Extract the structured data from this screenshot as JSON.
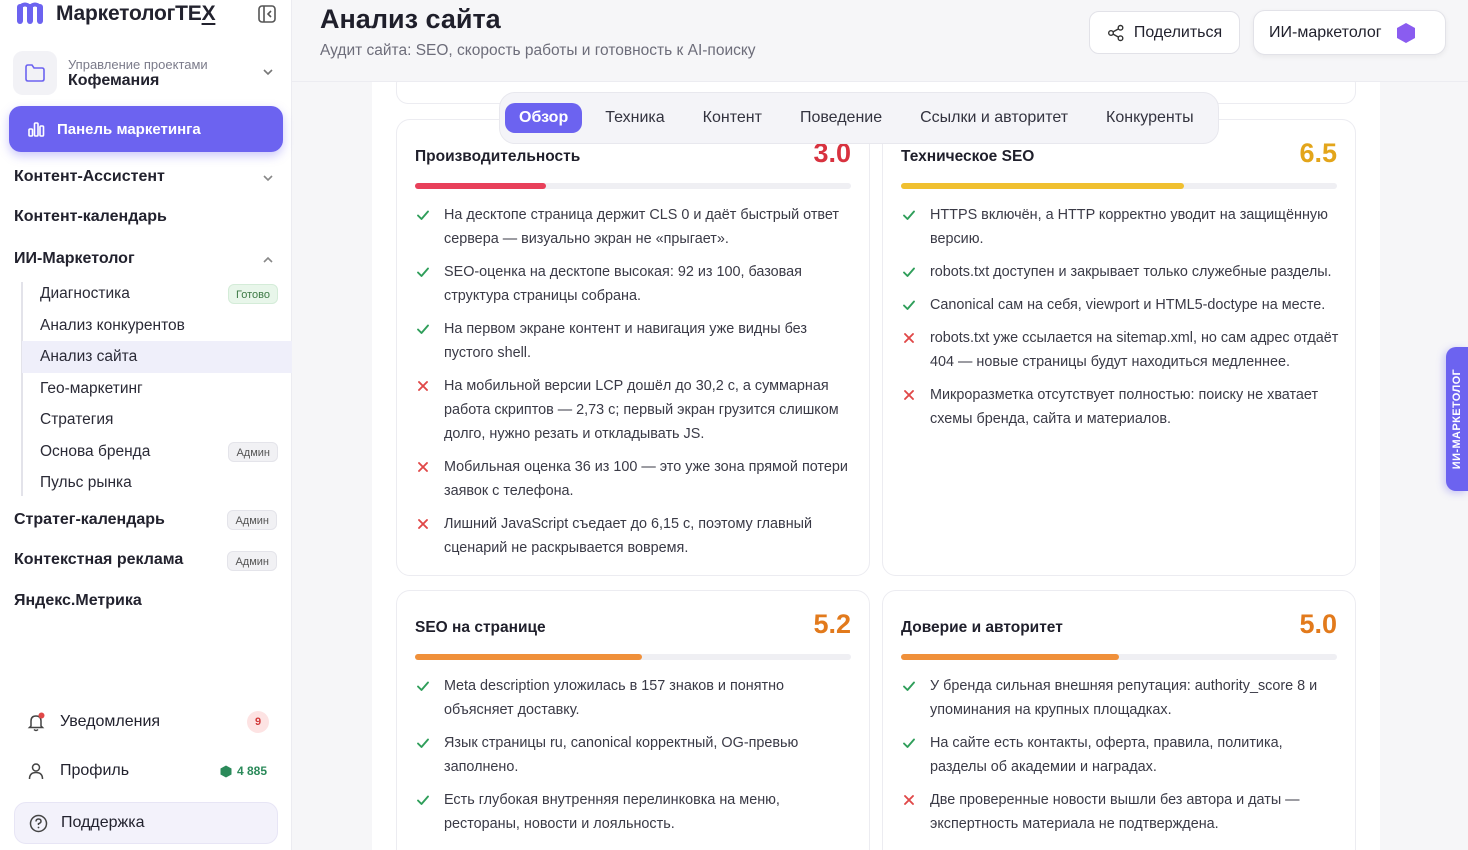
{
  "app": {
    "brand": "МаркетологТЕ",
    "brand_suffix": "Х"
  },
  "project": {
    "caption": "Управление проектами",
    "name": "Кофемания"
  },
  "sidebar": {
    "panel_label": "Панель маркетинга",
    "content_assistant": "Контент-Ассистент",
    "content_calendar": "Контент-календарь",
    "ai_marketer": "ИИ-Маркетолог",
    "sub_items": [
      {
        "label": "Диагностика",
        "badge": "Готово"
      },
      {
        "label": "Анализ конкурентов",
        "badge": ""
      },
      {
        "label": "Анализ сайта",
        "badge": ""
      },
      {
        "label": "Гео-маркетинг",
        "badge": ""
      },
      {
        "label": "Стратегия",
        "badge": ""
      },
      {
        "label": "Основа бренда",
        "badge": "Админ"
      },
      {
        "label": "Пульс рынка",
        "badge": ""
      }
    ],
    "strateg_calendar": "Стратег-календарь",
    "strateg_badge": "Админ",
    "context_ads": "Контекстная реклама",
    "context_badge": "Админ",
    "metrika": "Яндекс.Метрика",
    "notifications": "Уведомления",
    "notifications_count": "9",
    "profile": "Профиль",
    "balance": "4 885",
    "support": "Поддержка"
  },
  "header": {
    "title": "Анализ сайта",
    "subtitle": "Аудит сайта: SEO, скорость работы и готовность к AI-поиску",
    "share": "Поделиться",
    "ai_button": "ИИ-маркетолог"
  },
  "tabs": [
    "Обзор",
    "Техника",
    "Контент",
    "Поведение",
    "Ссылки и авторитет",
    "Конкуренты"
  ],
  "side_tab": "ИИ-МАРКЕТОЛОГ",
  "colors": {
    "accent": "#6c63f0",
    "ok": "#2f9e5a",
    "bad": "#e04848"
  },
  "cards": [
    {
      "title": "Производительность",
      "score": "3.0",
      "score_value": 3.0,
      "color": "#e8405a",
      "items": [
        {
          "ok": true,
          "text": "На десктопе страница держит CLS 0 и даёт быстрый ответ сервера — визуально экран не «прыгает»."
        },
        {
          "ok": true,
          "text": "SEO-оценка на десктопе высокая: 92 из 100, базовая структура страницы собрана."
        },
        {
          "ok": true,
          "text": "На первом экране контент и навигация уже видны без пустого shell."
        },
        {
          "ok": false,
          "text": "На мобильной версии LCP дошёл до 30,2 с, а суммарная работа скриптов — 2,73 с; первый экран грузится слишком долго, нужно резать и откладывать JS."
        },
        {
          "ok": false,
          "text": "Мобильная оценка 36 из 100 — это уже зона прямой потери заявок с телефона."
        },
        {
          "ok": false,
          "text": "Лишний JavaScript съедает до 6,15 с, поэтому главный сценарий не раскрывается вовремя."
        }
      ]
    },
    {
      "title": "Техническое SEO",
      "score": "6.5",
      "score_value": 6.5,
      "color": "#f0c030",
      "items": [
        {
          "ok": true,
          "text": "HTTPS включён, а HTTP корректно уводит на защищённую версию."
        },
        {
          "ok": true,
          "text": "robots.txt доступен и закрывает только служебные разделы."
        },
        {
          "ok": true,
          "text": "Canonical сам на себя, viewport и HTML5-doctype на месте."
        },
        {
          "ok": false,
          "text": "robots.txt уже ссылается на sitemap.xml, но сам адрес отдаёт 404 — новые страницы будут находиться медленнее."
        },
        {
          "ok": false,
          "text": "Микроразметка отсутствует полностью: поиску не хватает схемы бренда, сайта и материалов."
        }
      ]
    },
    {
      "title": "SEO на странице",
      "score": "5.2",
      "score_value": 5.2,
      "color": "#f0903a",
      "items": [
        {
          "ok": true,
          "text": "Meta description уложилась в 157 знаков и понятно объясняет доставку."
        },
        {
          "ok": true,
          "text": "Язык страницы ru, canonical корректный, OG-превью заполнено."
        },
        {
          "ok": true,
          "text": "Есть глубокая внутренняя перелинковка на меню, рестораны, новости и лояльность."
        }
      ]
    },
    {
      "title": "Доверие и авторитет",
      "score": "5.0",
      "score_value": 5.0,
      "color": "#f0903a",
      "items": [
        {
          "ok": true,
          "text": "У бренда сильная внешняя репутация: authority_score 8 и упоминания на крупных площадках."
        },
        {
          "ok": true,
          "text": "На сайте есть контакты, оферта, правила, политика, разделы об академии и наградах."
        },
        {
          "ok": false,
          "text": "Две проверенные новости вышли без автора и даты — экспертность материала не подтверждена."
        }
      ]
    }
  ]
}
